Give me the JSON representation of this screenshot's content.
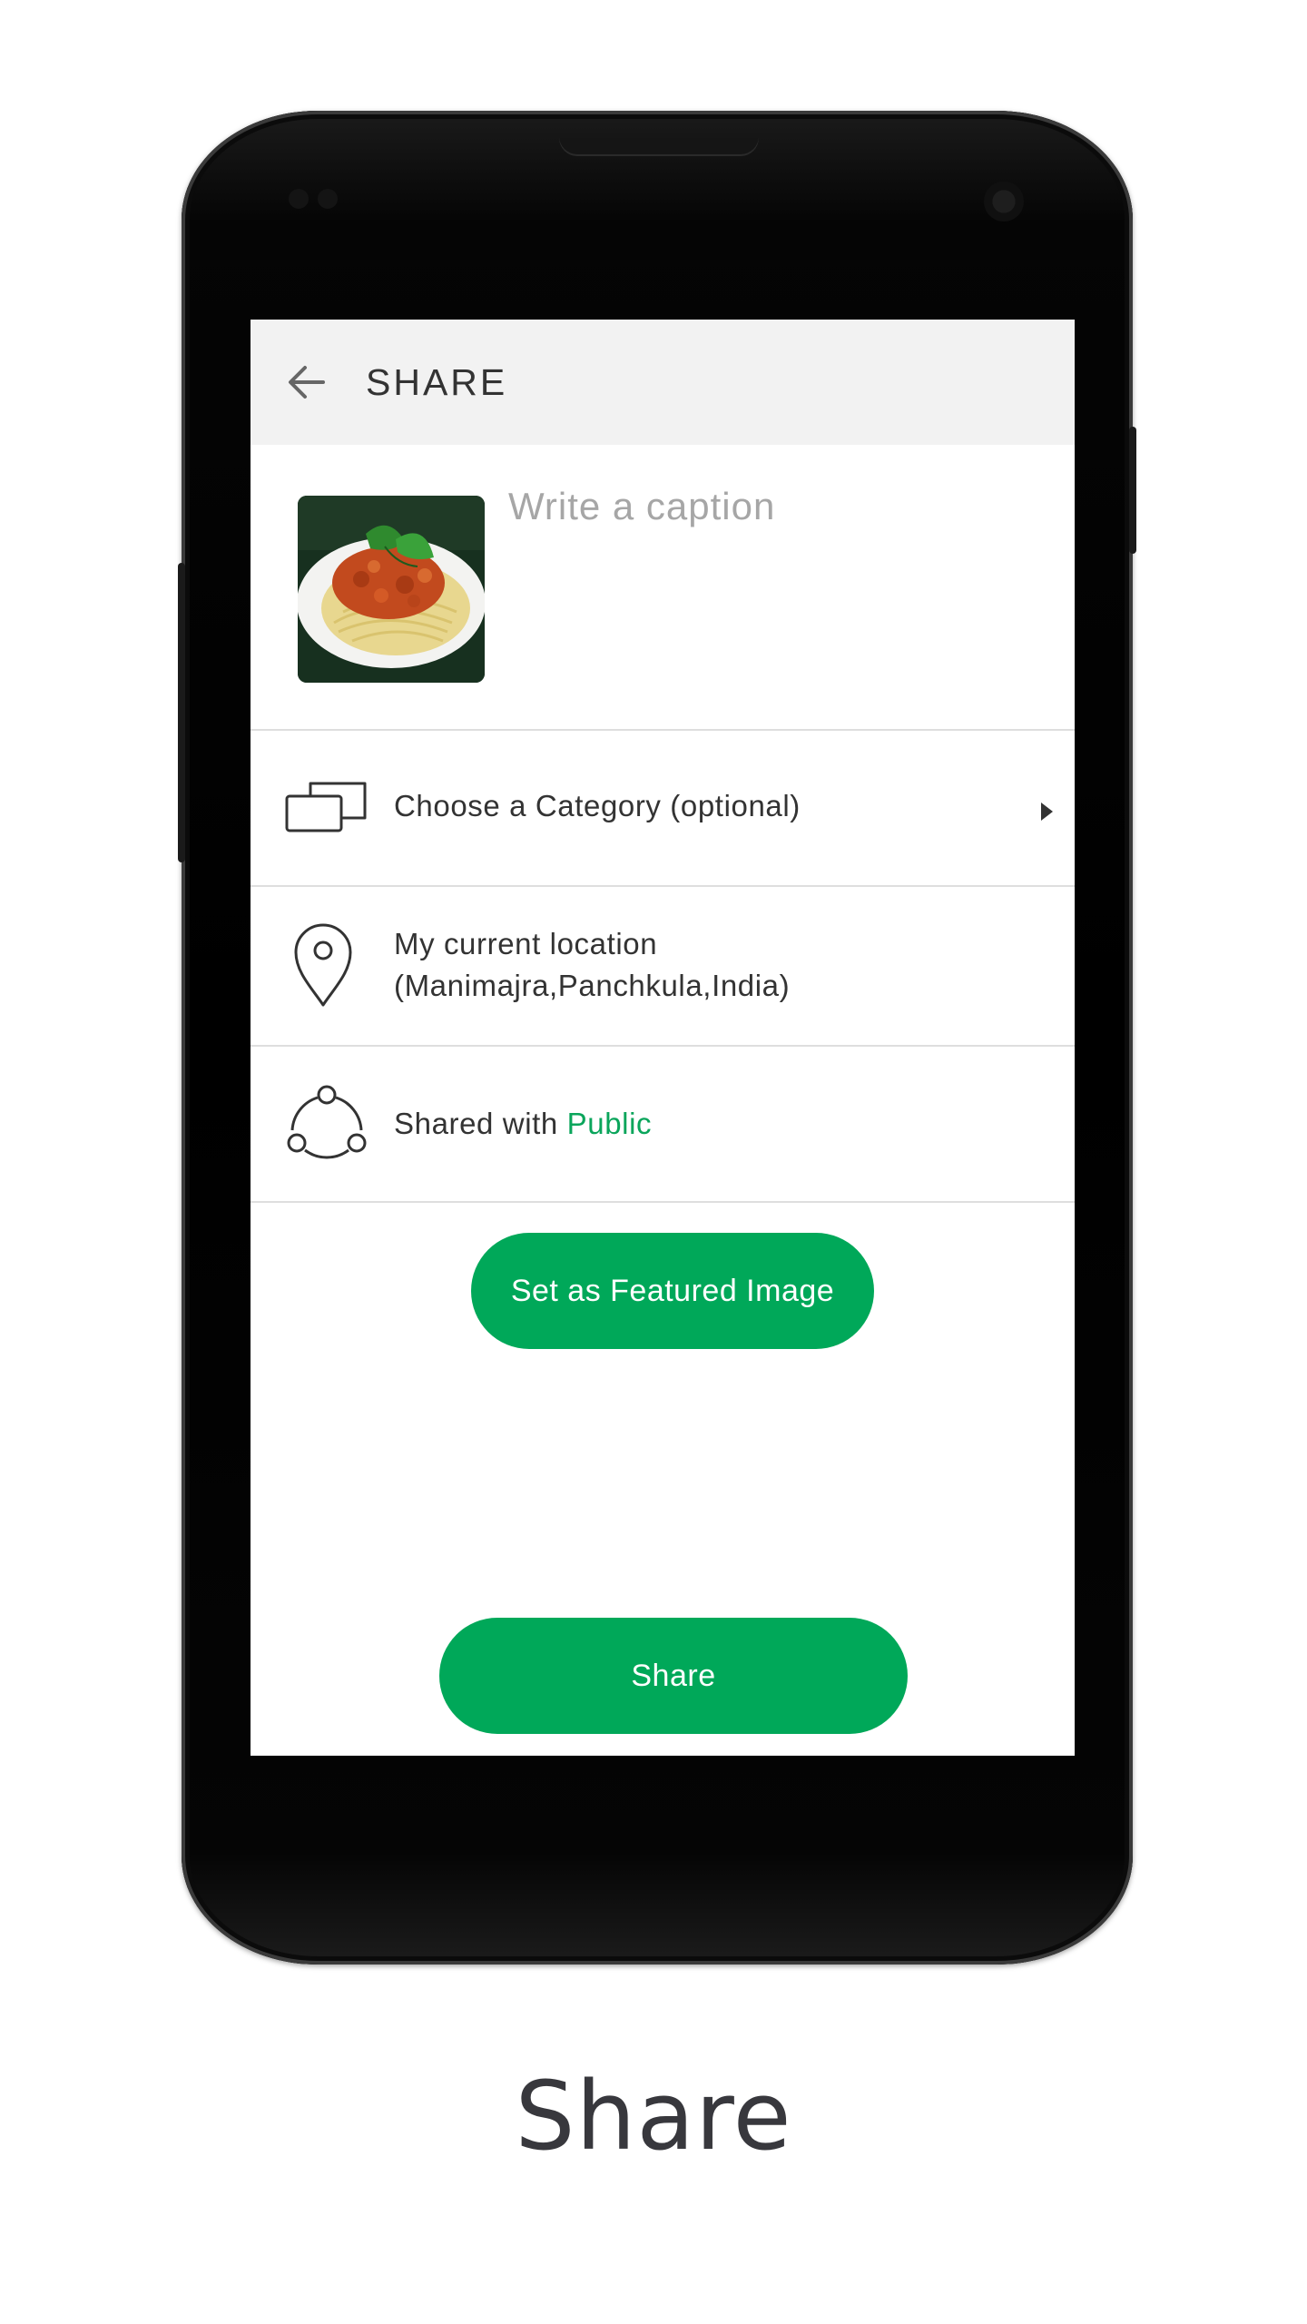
{
  "app": {
    "title": "SHARE",
    "caption": {
      "placeholder": "Write a caption",
      "value": ""
    },
    "photo": {
      "subject": "spaghetti-bolognese"
    },
    "options": {
      "category": {
        "label": "Choose a Category (optional)"
      },
      "location": {
        "line1": "My current location",
        "line2": "(Manimajra,Panchkula,India)"
      },
      "privacy": {
        "prefix": "Shared with",
        "value": "Public"
      }
    },
    "buttons": {
      "featured": "Set as Featured Image",
      "share": "Share"
    }
  },
  "page_caption": "Share",
  "colors": {
    "accent": "#00a859",
    "appbar": "#f2f2f2",
    "text": "#333333",
    "placeholder": "#a6a6a6"
  },
  "icons": [
    "back-arrow-icon",
    "category-cards-icon",
    "location-pin-icon",
    "share-circle-icon",
    "chevron-right-icon"
  ]
}
